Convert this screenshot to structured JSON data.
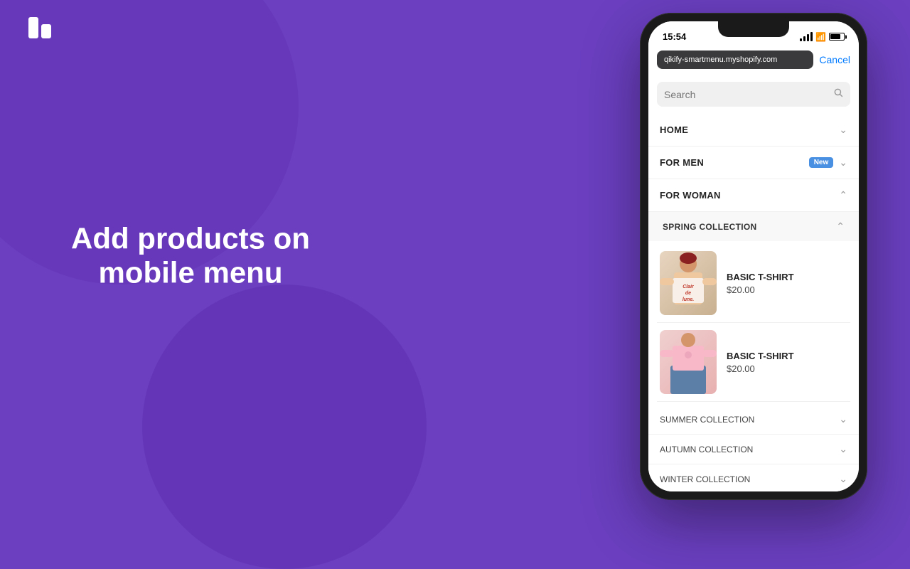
{
  "background": {
    "color": "#6b3fc0"
  },
  "logo": {
    "aria": "Qikify logo"
  },
  "hero": {
    "line1": "Add products on",
    "line2": "mobile menu"
  },
  "phone": {
    "status_bar": {
      "time": "15:54",
      "signal_icon": "signal",
      "wifi_icon": "wifi",
      "battery_icon": "battery"
    },
    "url_bar": {
      "url": "qikify-smartmenu.myshopify.com",
      "cancel_label": "Cancel"
    },
    "search": {
      "placeholder": "Search"
    },
    "menu_items": [
      {
        "label": "HOME",
        "badge": null,
        "state": "collapsed"
      },
      {
        "label": "FOR MEN",
        "badge": "New",
        "state": "collapsed"
      },
      {
        "label": "FOR WOMAN",
        "badge": null,
        "state": "expanded"
      }
    ],
    "submenu": {
      "label": "SPRING COLLECTION",
      "state": "expanded",
      "products": [
        {
          "name": "BASIC T-SHIRT",
          "price": "$20.00",
          "image_type": "shirt1"
        },
        {
          "name": "BASIC T-SHIRT",
          "price": "$20.00",
          "image_type": "shirt2"
        }
      ]
    },
    "sub_collections": [
      {
        "label": "SUMMER COLLECTION"
      },
      {
        "label": "AUTUMN COLLECTION"
      },
      {
        "label": "WINTER COLLECTION"
      }
    ]
  }
}
